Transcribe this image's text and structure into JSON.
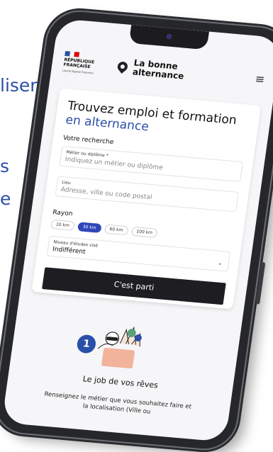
{
  "background": {
    "line1": "liser",
    "line2": "s",
    "line3": "e"
  },
  "header": {
    "rf_line1": "RÉPUBLIQUE",
    "rf_line2": "FRANÇAISE",
    "rf_motto": "Liberté Égalité Fraternité",
    "brand_line1": "La bonne",
    "brand_line2": "alternance",
    "menu_icon": "hamburger-menu-icon"
  },
  "search": {
    "title": "Trouvez emploi et formation",
    "title_accent": "en alternance",
    "section_label": "Votre recherche",
    "metier_label": "Métier ou diplôme *",
    "metier_placeholder": "Indiquez un métier ou diplôme",
    "lieu_label": "Lieu",
    "lieu_placeholder": "Adresse, ville ou code postal",
    "rayon_label": "Rayon",
    "rayon_options": [
      "10 km",
      "30 km",
      "60 km",
      "100 km"
    ],
    "rayon_selected": "30 km",
    "niveau_label": "Niveau d'études visé",
    "niveau_value": "Indifférent",
    "submit_label": "C'est parti"
  },
  "step": {
    "number": "1",
    "title": "Le job de vos rêves",
    "description": "Renseignez le métier que vous souhaitez faire et la localisation (Ville ou"
  },
  "colors": {
    "accent": "#2a4fa8",
    "chip_active": "#3146b8",
    "button": "#1e1e22"
  }
}
